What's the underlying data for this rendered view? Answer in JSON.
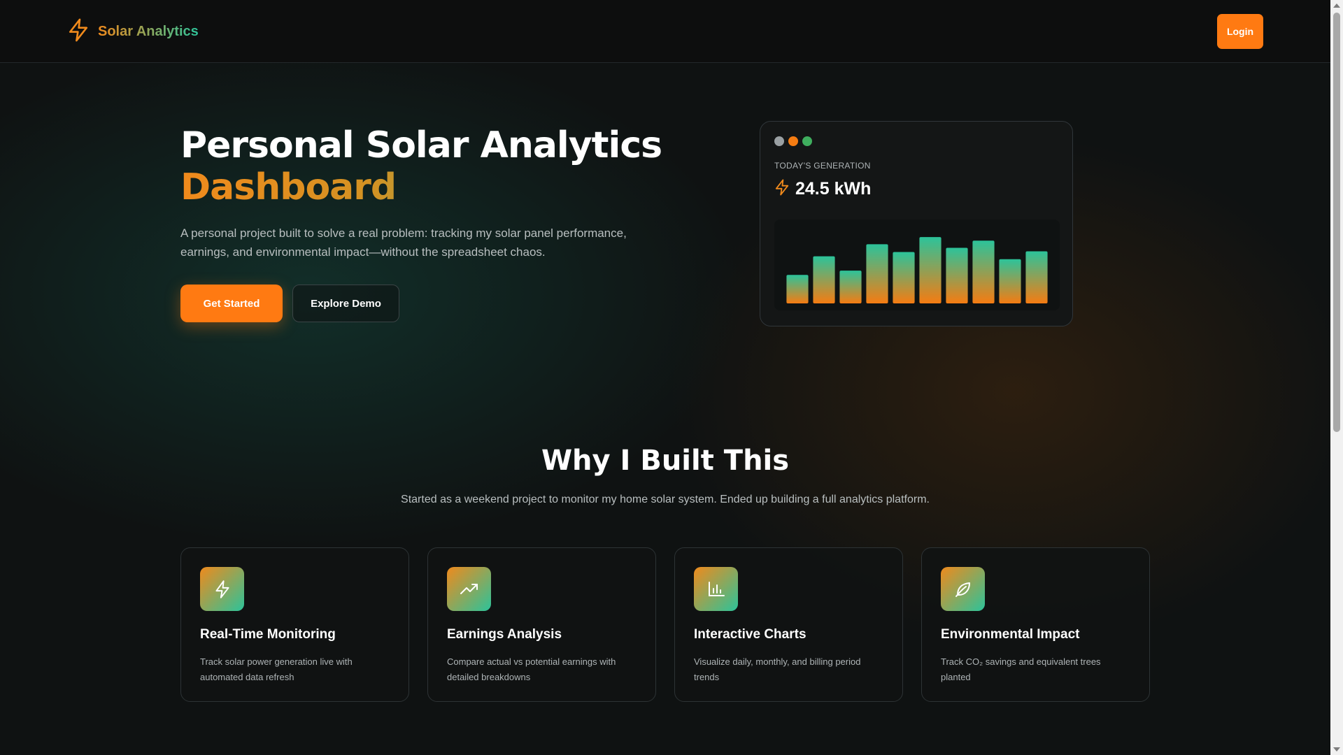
{
  "header": {
    "brand_name": "Solar Analytics",
    "brand_icon": "lightning-bolt-icon",
    "login_label": "Login"
  },
  "hero": {
    "title_line1": "Personal Solar Analytics",
    "title_line2": "Dashboard",
    "subtitle": "A personal project built to solve a real problem: tracking my solar panel performance, earnings, and environmental impact—without the spreadsheet chaos.",
    "primary_button": "Get Started",
    "secondary_button": "Explore Demo"
  },
  "preview_card": {
    "window_dots": [
      "#9aa0a3",
      "#f57c12",
      "#3fae5e"
    ],
    "label": "TODAY'S GENERATION",
    "value": "24.5 kWh"
  },
  "chart_data": {
    "type": "bar",
    "values": [
      40,
      66,
      46,
      83,
      72,
      93,
      78,
      88,
      62,
      73
    ],
    "ylim": [
      0,
      100
    ],
    "gradient": [
      "#2cc39a",
      "#f57c12"
    ]
  },
  "why": {
    "title": "Why I Built This",
    "subtitle": "Started as a weekend project to monitor my home solar system. Ended up building a full analytics platform.",
    "features": [
      {
        "icon": "lightning-bolt-icon",
        "title": "Real-Time Monitoring",
        "description": "Track solar power generation live with automated data refresh"
      },
      {
        "icon": "trending-up-icon",
        "title": "Earnings Analysis",
        "description": "Compare actual vs potential earnings with detailed breakdowns"
      },
      {
        "icon": "bar-chart-icon",
        "title": "Interactive Charts",
        "description": "Visualize daily, monthly, and billing period trends"
      },
      {
        "icon": "leaf-icon",
        "title": "Environmental Impact",
        "description": "Track CO₂ savings and equivalent trees planted"
      }
    ]
  },
  "colors": {
    "accent_orange": "#ff7a12",
    "accent_teal": "#2cc39a",
    "background": "#0f1212"
  }
}
